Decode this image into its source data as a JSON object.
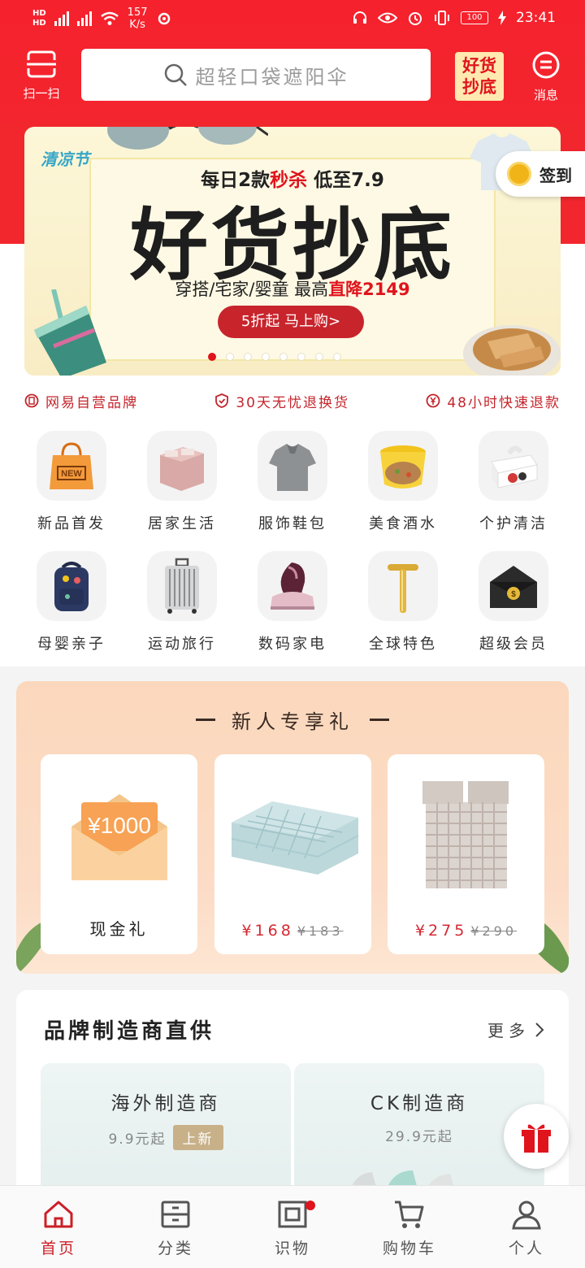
{
  "status": {
    "network_a": "HD",
    "network_b": "HD",
    "speed_value": "157",
    "speed_unit": "K/s",
    "battery": "100",
    "time": "23:41"
  },
  "header": {
    "scan_label": "扫一扫",
    "search_placeholder": "超轻口袋遮阳伞",
    "promo_line1": "好货",
    "promo_line2": "抄底",
    "messages_label": "消息"
  },
  "banner": {
    "tag": "清凉节",
    "line1_a": "每日2款",
    "line1_b": "秒杀",
    "line1_c": " 低至7.9",
    "title": "好货抄底",
    "line2_a": "穿搭/宅家/婴童 最高",
    "line2_b": "直降2149",
    "cta": "5折起 马上购>",
    "slide_count": 8,
    "active_slide": 0
  },
  "signin_label": "签到",
  "guarantees": [
    {
      "icon": "brand-icon",
      "label": "网易自营品牌"
    },
    {
      "icon": "shield-icon",
      "label": "30天无忧退换货"
    },
    {
      "icon": "yen-icon",
      "label": "48小时快速退款"
    }
  ],
  "categories": [
    {
      "label": "新品首发",
      "icon": "new-bag-icon"
    },
    {
      "label": "居家生活",
      "icon": "bedding-icon"
    },
    {
      "label": "服饰鞋包",
      "icon": "shirt-icon"
    },
    {
      "label": "美食酒水",
      "icon": "noodle-icon"
    },
    {
      "label": "个护清洁",
      "icon": "tissue-icon"
    },
    {
      "label": "母婴亲子",
      "icon": "backpack-icon"
    },
    {
      "label": "运动旅行",
      "icon": "suitcase-icon"
    },
    {
      "label": "数码家电",
      "icon": "mite-vacuum-icon"
    },
    {
      "label": "全球特色",
      "icon": "beauty-roller-icon"
    },
    {
      "label": "超级会员",
      "icon": "vip-envelope-icon"
    }
  ],
  "newcomer": {
    "title": "新人专享礼",
    "items": [
      {
        "label": "现金礼",
        "badge": "¥1000"
      },
      {
        "price": "¥168",
        "old_price": "¥183"
      },
      {
        "price": "¥275",
        "old_price": "¥290"
      }
    ]
  },
  "brand": {
    "title": "品牌制造商直供",
    "more": "更多",
    "boxes": [
      {
        "title": "海外制造商",
        "sub": "9.9元起",
        "badge": "上新"
      },
      {
        "title": "CK制造商",
        "sub": "29.9元起"
      }
    ]
  },
  "tabs": [
    {
      "label": "首页",
      "active": true
    },
    {
      "label": "分类"
    },
    {
      "label": "识物",
      "dot": true
    },
    {
      "label": "购物车"
    },
    {
      "label": "个人"
    }
  ],
  "colors": {
    "brand_red": "#f2272e",
    "accent_red": "#cc1f27",
    "banner_cta": "#c8242c",
    "newcomer_bg": "#fbd8bd"
  }
}
